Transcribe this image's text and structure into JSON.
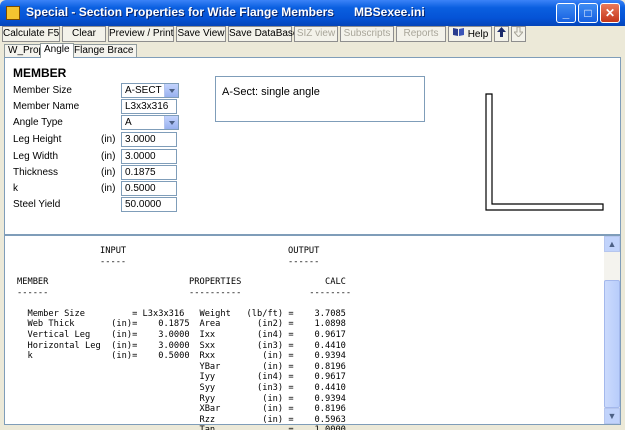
{
  "window": {
    "title": "Special - Section Properties for Wide Flange Members      MBSexee.ini",
    "minimize": "_",
    "maximize": "□",
    "close": "✕"
  },
  "toolbar": {
    "calculate": "Calculate F5",
    "clear": "Clear",
    "preview": "Preview / Print F7",
    "save_view": "Save View",
    "save_db": "Save DataBase",
    "siz_view": "SIZ view",
    "subscripts": "Subscripts",
    "reports": "Reports",
    "help": "Help"
  },
  "tabs": [
    "W_Prop",
    "Angle",
    "Flange Brace"
  ],
  "member": {
    "heading": "MEMBER",
    "fields": {
      "member_size": {
        "label": "Member Size",
        "value": "A-SECT"
      },
      "member_name": {
        "label": "Member Name",
        "value": "L3x3x316"
      },
      "angle_type": {
        "label": "Angle Type",
        "value": "A"
      },
      "leg_height": {
        "label": "Leg Height",
        "unit": "(in)",
        "value": "3.0000"
      },
      "leg_width": {
        "label": "Leg Width",
        "unit": "(in)",
        "value": "3.0000"
      },
      "thickness": {
        "label": "Thickness",
        "unit": "(in)",
        "value": "0.1875"
      },
      "k": {
        "label": "k",
        "unit": "(in)",
        "value": "0.5000"
      },
      "steel_yield": {
        "label": "Steel Yield",
        "value": "50.0000"
      }
    },
    "description": "A-Sect: single angle"
  },
  "output": {
    "input_header": "INPUT\n-----",
    "output_header": "OUTPUT\n------",
    "member_block": "MEMBER\n------\n\n  Member Size         = L3x3x316\n  Web Thick       (in)=    0.1875\n  Vertical Leg    (in)=    3.0000\n  Horizontal Leg  (in)=    3.0000\n  k               (in)=    0.5000",
    "properties_block": "PROPERTIES                CALC\n----------             --------\n\n  Weight   (lb/ft) =    3.7085\n  Area       (in2) =    1.0898\n  Ixx        (in4) =    0.9617\n  Sxx        (in3) =    0.4410\n  Rxx         (in) =    0.9394\n  YBar        (in) =    0.8196\n  Iyy        (in4) =    0.9617\n  Syy        (in3) =    0.4410\n  Ryy         (in) =    0.9394\n  XBar        (in) =    0.8196\n  Rzz         (in) =    0.5963\n  Tan              =    1.0000"
  }
}
